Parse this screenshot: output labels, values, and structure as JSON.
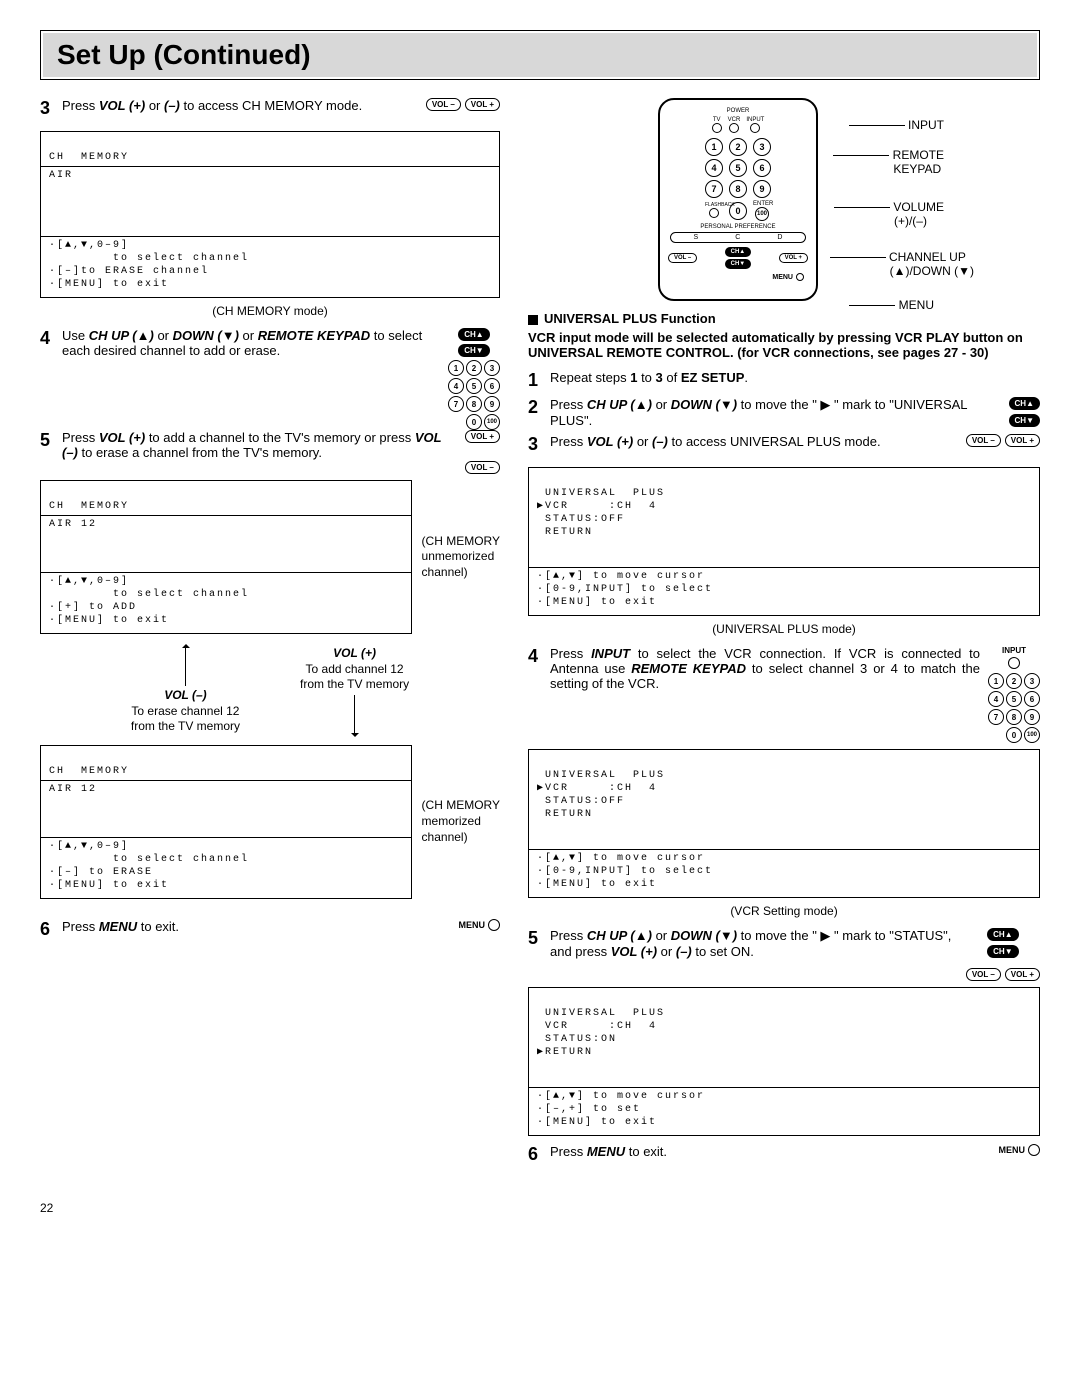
{
  "title": "Set Up (Continued)",
  "page_number": "22",
  "left": {
    "step3": {
      "text_a": "Press ",
      "text_b": "VOL (+)",
      "text_c": " or ",
      "text_d": "(–)",
      "text_e": " to access CH MEMORY mode."
    },
    "osd1": {
      "l1": "CH  MEMORY",
      "l2": "AIR",
      "h1": "·[▲,▼,0–9]",
      "h2": "        to select channel",
      "h3": "·[–]to ERASE channel",
      "h4": "·[MENU] to exit"
    },
    "caption1": "(CH MEMORY mode)",
    "step4": {
      "a": "Use ",
      "b": "CH UP (▲)",
      "c": " or ",
      "d": "DOWN (▼)",
      "e": " or ",
      "f": "REMOTE KEYPAD",
      "g": " to select each desired channel to add or erase."
    },
    "step5": {
      "a": "Press ",
      "b": "VOL (+)",
      "c": " to add a channel to the TV's memory or press ",
      "d": "VOL (–)",
      "e": " to erase a channel from the TV's memory."
    },
    "osd2": {
      "l1": "CH  MEMORY",
      "l2": "AIR 12",
      "h1": "·[▲,▼,0–9]",
      "h2": "        to select channel",
      "h3": "·[+] to ADD",
      "h4": "·[MENU] to exit"
    },
    "side2a": "(CH MEMORY",
    "side2b": "unmemorized",
    "side2c": "channel)",
    "volplus_h": "VOL (+)",
    "volplus_1": "To add channel 12",
    "volplus_2": "from the TV memory",
    "volminus_h": "VOL (–)",
    "volminus_1": "To erase channel 12",
    "volminus_2": "from the TV memory",
    "osd3": {
      "l1": "CH  MEMORY",
      "l2": "AIR 12",
      "h1": "·[▲,▼,0–9]",
      "h2": "        to select channel",
      "h3": "·[–] to ERASE",
      "h4": "·[MENU] to exit"
    },
    "side3a": "(CH MEMORY",
    "side3b": "memorized",
    "side3c": "channel)",
    "step6": {
      "a": "Press ",
      "b": "MENU",
      "c": " to exit."
    },
    "btn_vol_m": "VOL –",
    "btn_vol_p": "VOL +",
    "btn_ch_u": "CH▲",
    "btn_ch_d": "CH▼",
    "btn_menu": "MENU"
  },
  "right": {
    "remote": {
      "power": "POWER",
      "tv": "TV",
      "vcr": "VCR",
      "input": "INPUT",
      "k1": "1",
      "k2": "2",
      "k3": "3",
      "k4": "4",
      "k5": "5",
      "k6": "6",
      "k7": "7",
      "k8": "8",
      "k9": "9",
      "k0": "0",
      "k100": "100",
      "flash": "FLASHBACK",
      "enter": "ENTER",
      "pref": "PERSONAL PREFERENCE",
      "s": "S",
      "c": "C",
      "d": "D",
      "vol_m": "VOL –",
      "vol_p": "VOL +",
      "ch_u": "CH▲",
      "ch_d": "CH▼",
      "menu": "MENU",
      "lbl_input": "INPUT",
      "lbl_keypad1": "REMOTE",
      "lbl_keypad2": "KEYPAD",
      "lbl_vol1": "VOLUME",
      "lbl_vol2": "(+)/(–)",
      "lbl_ch1": "CHANNEL UP",
      "lbl_ch2": "(▲)/DOWN (▼)",
      "lbl_menu": "MENU"
    },
    "section_h": "UNIVERSAL PLUS Function",
    "intro": "VCR input mode will be selected automatically by pressing VCR PLAY button on UNIVERSAL REMOTE CONTROL. (for VCR connections, see pages 27 - 30)",
    "r1": {
      "a": "Repeat steps ",
      "b": "1",
      "c": " to ",
      "d": "3",
      "e": " of ",
      "f": "EZ SETUP",
      "g": "."
    },
    "r2": {
      "a": "Press ",
      "b": "CH UP (▲)",
      "c": " or ",
      "d": "DOWN (▼)",
      "e": " to move the \" ▶ \" mark to \"UNIVERSAL PLUS\"."
    },
    "r3": {
      "a": "Press ",
      "b": "VOL (+)",
      "c": " or ",
      "d": "(–)",
      "e": " to access UNIVERSAL PLUS mode."
    },
    "osd_up": {
      "l1": " UNIVERSAL  PLUS",
      "l2": "▶VCR     :CH  4",
      "l3": " STATUS:OFF",
      "l4": " RETURN",
      "h1": "·[▲,▼] to move cursor",
      "h2": "·[0-9,INPUT] to select",
      "h3": "·[MENU] to exit"
    },
    "caption_up": "(UNIVERSAL PLUS mode)",
    "r4": {
      "a": "Press ",
      "b": "INPUT",
      "c": " to select the VCR connection. If VCR is connected to Antenna use ",
      "d": "REMOTE KEYPAD",
      "e": " to select channel 3 or 4 to match the setting of the VCR."
    },
    "osd_vcr": {
      "l1": " UNIVERSAL  PLUS",
      "l2": "▶VCR     :CH  4",
      "l3": " STATUS:OFF",
      "l4": " RETURN",
      "h1": "·[▲,▼] to move cursor",
      "h2": "·[0-9,INPUT] to select",
      "h3": "·[MENU] to exit"
    },
    "caption_vcr": "(VCR Setting mode)",
    "r5": {
      "a": "Press ",
      "b": "CH UP (▲)",
      "c": " or ",
      "d": "DOWN (▼)",
      "e": " to move the \" ▶ \" mark to \"STATUS\", and press ",
      "f": "VOL (+)",
      "g": " or ",
      "h": "(–)",
      "i": " to set ON."
    },
    "osd_on": {
      "l1": " UNIVERSAL  PLUS",
      "l2": " VCR     :CH  4",
      "l3": " STATUS:ON",
      "l4": "▶RETURN",
      "h1": "·[▲,▼] to move cursor",
      "h2": "·[–,+] to set",
      "h3": "·[MENU] to exit"
    },
    "r6": {
      "a": "Press ",
      "b": "MENU",
      "c": " to exit."
    },
    "btn_input": "INPUT"
  }
}
